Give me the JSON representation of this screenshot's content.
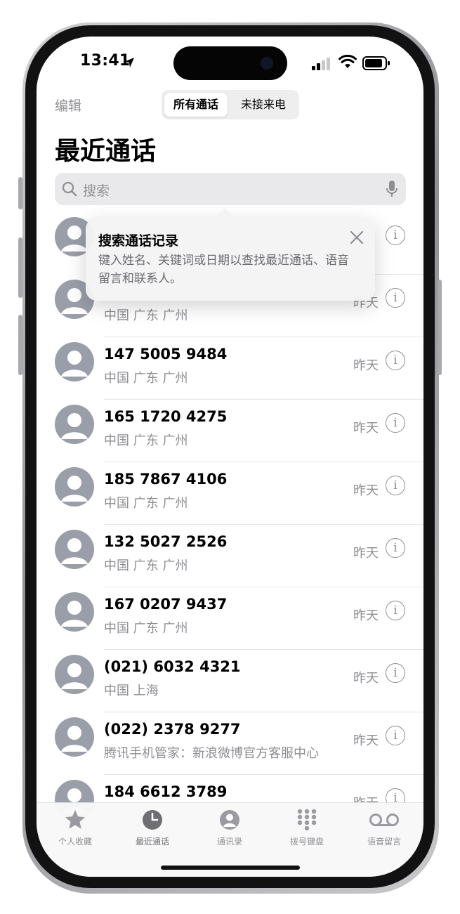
{
  "status_bar": {
    "time": "13:41"
  },
  "nav": {
    "edit_label": "编辑",
    "segments": [
      "所有通话",
      "未接来电"
    ],
    "selected_segment": "所有通话"
  },
  "page_title": "最近通话",
  "search": {
    "placeholder": "搜索"
  },
  "tooltip": {
    "title": "搜索通话记录",
    "body": "键入姓名、关键词或日期以查找最近通话、语音留言和联系人。"
  },
  "calls": [
    {
      "number": "",
      "location": "",
      "date": ""
    },
    {
      "number": "",
      "location": "中国 广东 广州",
      "date": "昨天"
    },
    {
      "number": "147 5005 9484",
      "location": "中国 广东 广州",
      "date": "昨天"
    },
    {
      "number": "165 1720 4275",
      "location": "中国 广东 广州",
      "date": "昨天"
    },
    {
      "number": "185 7867 4106",
      "location": "中国 广东 广州",
      "date": "昨天"
    },
    {
      "number": "132 5027 2526",
      "location": "中国 广东 广州",
      "date": "昨天"
    },
    {
      "number": "167 0207 9437",
      "location": "中国 广东 广州",
      "date": "昨天"
    },
    {
      "number": "(021) 6032 4321",
      "location": "中国 上海",
      "date": "昨天"
    },
    {
      "number": "(022) 2378 9277",
      "location": "腾讯手机管家：新浪微博官方客服中心",
      "date": "昨天"
    },
    {
      "number": "184 6612 3789",
      "location": "",
      "date": "昨天"
    }
  ],
  "tabbar": {
    "items": [
      {
        "label": "个人收藏",
        "icon": "star-icon"
      },
      {
        "label": "最近通话",
        "icon": "clock-icon"
      },
      {
        "label": "通讯录",
        "icon": "person-circle-icon"
      },
      {
        "label": "拨号键盘",
        "icon": "keypad-icon"
      },
      {
        "label": "语音留言",
        "icon": "voicemail-icon"
      }
    ],
    "selected": "最近通话"
  },
  "colors": {
    "label_secondary": "#8e8e93",
    "label_primary": "#000000",
    "tab_selected": "#6e6e73"
  }
}
